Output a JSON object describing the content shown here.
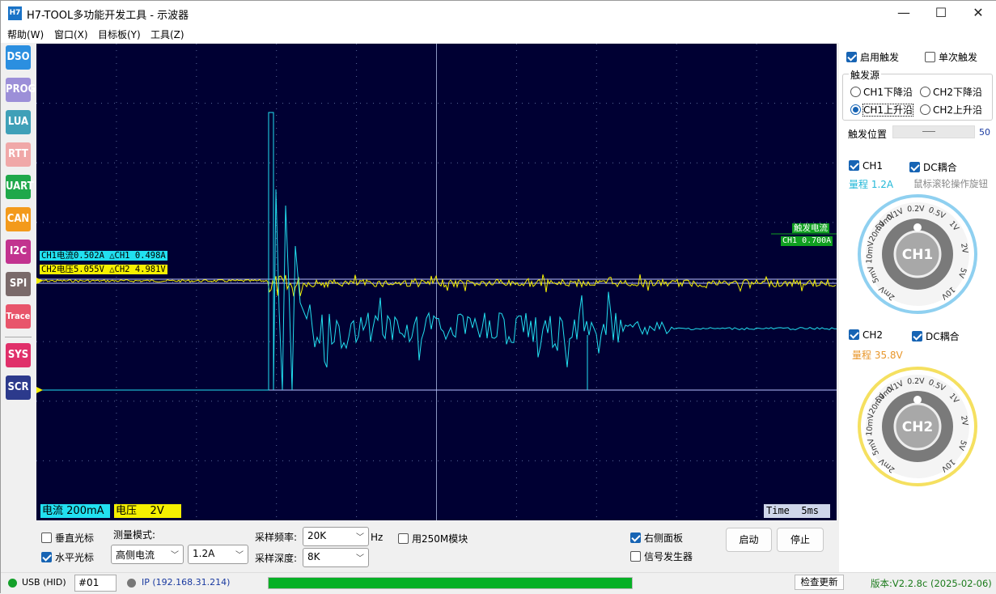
{
  "window": {
    "icon_text": "H7",
    "title": "H7-TOOL多功能开发工具 - 示波器",
    "minimize": "—",
    "maximize": "☐",
    "close": "✕"
  },
  "menu": [
    "帮助(W)",
    "窗口(X)",
    "目标板(Y)",
    "工具(Z)"
  ],
  "sidebar": [
    {
      "label": "DSO",
      "color": "#2b8fe0"
    },
    {
      "label": "PROG",
      "color": "#9c8fd8"
    },
    {
      "label": "LUA",
      "color": "#3fa0b8"
    },
    {
      "label": "RTT",
      "color": "#f0a8a8"
    },
    {
      "label": "UART",
      "color": "#1fa84a"
    },
    {
      "label": "CAN",
      "color": "#f39a1b"
    },
    {
      "label": "I2C",
      "color": "#c2338f"
    },
    {
      "label": "SPI",
      "color": "#7a6a6a"
    },
    {
      "label": "Trace",
      "color": "#e8556b"
    },
    {
      "label": "SYS",
      "color": "#e0306a"
    },
    {
      "label": "SCR",
      "color": "#2c3a8c"
    }
  ],
  "scope": {
    "ch1_readout": "CH1电流0.502A  △CH1 0.498A",
    "ch2_readout": "CH2电压5.055V  △CH2 4.981V",
    "trigger_label": "触发电流",
    "trigger_value": "CH1 0.700A",
    "ch1_scale_name": "电流",
    "ch1_scale_value": "200mA",
    "ch2_scale_name": "电压",
    "ch2_scale_value": "2V",
    "time_name": "Time",
    "time_value": "5ms",
    "colors": {
      "ch1": "#22e0f0",
      "ch2": "#f5f000",
      "bg": "#000033",
      "grid": "#5a6a9a"
    }
  },
  "right_panel": {
    "enable_trigger": "启用触发",
    "single_trigger": "单次触发",
    "trigger_source": "触发源",
    "ch1_falling": "CH1下降沿",
    "ch2_falling": "CH2下降沿",
    "ch1_rising": "CH1上升沿",
    "ch2_rising": "CH2上升沿",
    "trigger_pos_label": "触发位置",
    "trigger_pos_value": "50",
    "ch1": {
      "name": "CH1",
      "dc": "DC耦合",
      "range": "量程 1.2A",
      "hint": "鼠标滚轮操作旋钮",
      "knob": "CH1"
    },
    "ch2": {
      "name": "CH2",
      "dc": "DC耦合",
      "range": "量程 35.8V",
      "knob": "CH2"
    },
    "knob_labels": [
      "0.1V",
      "0.2V",
      "0.5V",
      "1V",
      "2V",
      "5V",
      "10V",
      "2mV",
      "5mV",
      "10mV",
      "20mV",
      "50mV"
    ]
  },
  "bottom": {
    "vertical_cursor": "垂直光标",
    "horizontal_cursor": "水平光标",
    "measure_mode_label": "测量模式:",
    "measure_mode_value": "高侧电流",
    "range_value": "1.2A",
    "sample_rate_label": "采样频率:",
    "sample_rate_value": "20K",
    "hz": "Hz",
    "sample_depth_label": "采样深度:",
    "sample_depth_value": "8K",
    "use_250m": "用250M模块",
    "right_panel_cb": "右侧面板",
    "signal_gen": "信号发生器",
    "start": "启动",
    "stop": "停止"
  },
  "status": {
    "usb": "USB (HID)",
    "device": "#01",
    "ip": "IP (192.168.31.214)",
    "progress": 1.0,
    "check_update": "检查更新",
    "version": "版本:V2.2.8c (2025-02-06)"
  }
}
